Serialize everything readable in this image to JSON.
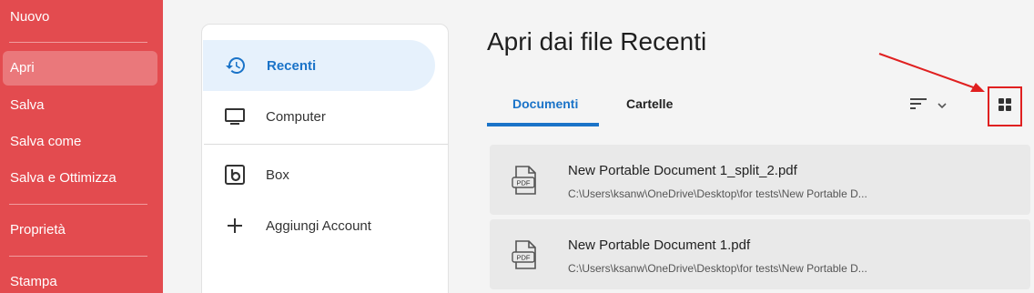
{
  "sidebar": {
    "items": [
      {
        "label": "Nuovo"
      },
      {
        "label": "Apri"
      },
      {
        "label": "Salva"
      },
      {
        "label": "Salva come"
      },
      {
        "label": "Salva e Ottimizza"
      },
      {
        "label": "Proprietà"
      },
      {
        "label": "Stampa"
      }
    ],
    "active": "Apri",
    "color": "#e34b4f"
  },
  "sources": {
    "items": [
      {
        "label": "Recenti",
        "icon": "history-icon"
      },
      {
        "label": "Computer",
        "icon": "monitor-icon"
      },
      {
        "label": "Box",
        "icon": "box-icon"
      },
      {
        "label": "Aggiungi Account",
        "icon": "plus-icon"
      }
    ],
    "active": "Recenti",
    "accent": "#1a73c8"
  },
  "main": {
    "title": "Apri dai file Recenti",
    "tabs": [
      {
        "label": "Documenti"
      },
      {
        "label": "Cartelle"
      }
    ],
    "active_tab": "Documenti",
    "sort_icon": "sort-icon",
    "view_icon": "grid-view-icon",
    "highlight_color": "#e02020"
  },
  "files": [
    {
      "name": "New Portable Document 1_split_2.pdf",
      "path": "C:\\Users\\ksanw\\OneDrive\\Desktop\\for tests\\New Portable D...",
      "icon_text": "PDF"
    },
    {
      "name": "New Portable Document 1.pdf",
      "path": "C:\\Users\\ksanw\\OneDrive\\Desktop\\for tests\\New Portable D...",
      "icon_text": "PDF"
    }
  ]
}
